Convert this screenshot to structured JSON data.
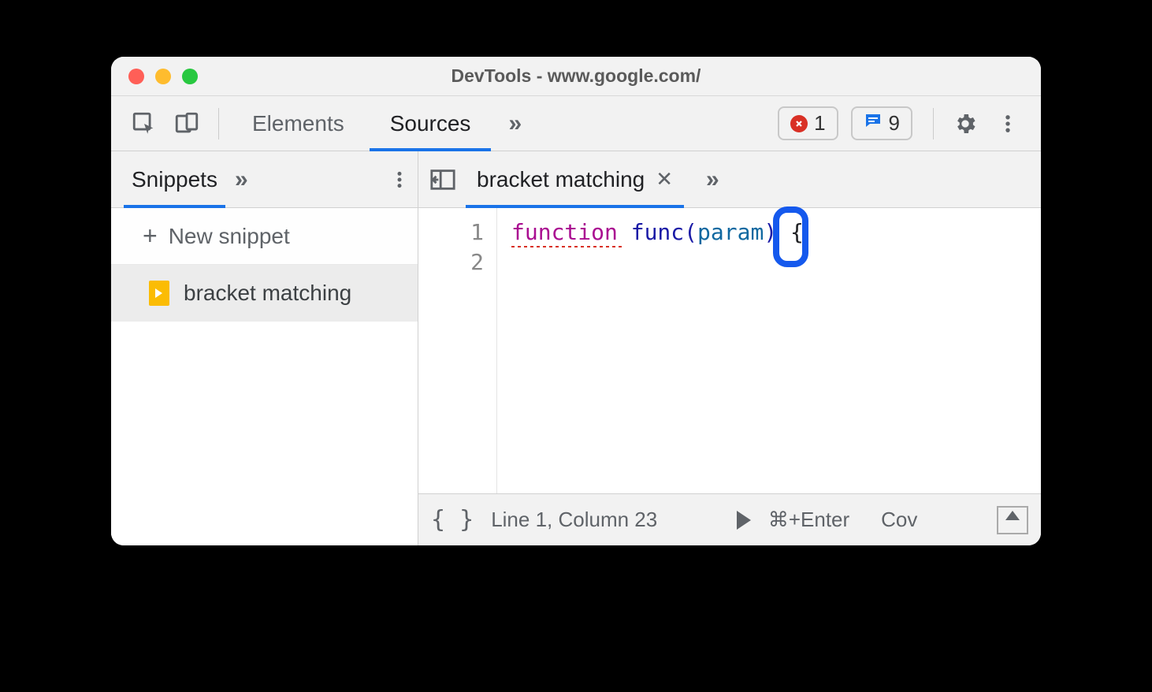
{
  "window": {
    "title": "DevTools - www.google.com/"
  },
  "top_tabs": {
    "elements": "Elements",
    "sources": "Sources",
    "active": "sources"
  },
  "badges": {
    "errors": "1",
    "messages": "9"
  },
  "sidebar": {
    "tab_label": "Snippets",
    "new_snippet": "New snippet",
    "items": [
      {
        "label": "bracket matching"
      }
    ]
  },
  "editor": {
    "tab_label": "bracket matching",
    "line_numbers": [
      "1",
      "2"
    ],
    "code": {
      "keyword": "function",
      "fn_name": "func",
      "open_paren": "(",
      "param": "param",
      "close_paren": ")",
      "space": " ",
      "brace": "{"
    }
  },
  "statusbar": {
    "format_icon": "{ }",
    "position": "Line 1, Column 23",
    "run_shortcut": "⌘+Enter",
    "coverage": "Cov"
  }
}
